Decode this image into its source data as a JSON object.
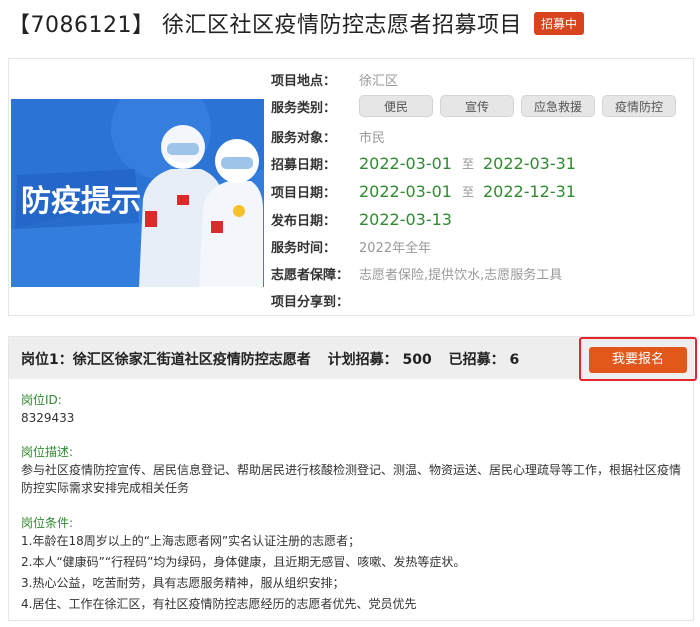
{
  "header": {
    "title": "【7086121】 徐汇区社区疫情防控志愿者招募项目",
    "status_badge": "招募中"
  },
  "poster": {
    "headline": "防疫提示"
  },
  "info": {
    "location": {
      "label": "项目地点：",
      "value": "徐汇区"
    },
    "service_type": {
      "label": "服务类别：",
      "tags": [
        "便民",
        "宣传",
        "应急救援",
        "疫情防控"
      ]
    },
    "service_target": {
      "label": "服务对象：",
      "value": "市民"
    },
    "recruit_date": {
      "label": "招募日期：",
      "start": "2022-03-01",
      "separator": "至",
      "end": "2022-03-31"
    },
    "project_date": {
      "label": "项目日期：",
      "start": "2022-03-01",
      "separator": "至",
      "end": "2022-12-31"
    },
    "publish_date": {
      "label": "发布日期：",
      "value": "2022-03-13"
    },
    "service_time": {
      "label": "服务时间：",
      "value": "2022年全年"
    },
    "guarantee": {
      "label": "志愿者保障：",
      "value": "志愿者保险,提供饮水,志愿服务工具"
    },
    "share": {
      "label": "项目分享到："
    }
  },
  "position": {
    "title": "岗位1：徐汇区徐家汇街道社区疫情防控志愿者",
    "plan_label": "计划招募：",
    "plan_value": "500",
    "recruited_label": "已招募：",
    "recruited_value": "6",
    "apply_label": "我要报名",
    "id_heading": "岗位ID:",
    "id_value": "8329433",
    "desc_heading": "岗位描述:",
    "desc_text": "参与社区疫情防控宣传、居民信息登记、帮助居民进行核酸检测登记、测温、物资运送、居民心理疏导等工作，根据社区疫情防控实际需求安排完成相关任务",
    "cond_heading": "岗位条件:",
    "conditions": [
      "1.年龄在18周岁以上的“上海志愿者网”实名认证注册的志愿者；",
      "2.本人“健康码”“行程码”均为绿码，身体健康，且近期无感冒、咳嗽、发热等症状。",
      "3.热心公益，吃苦耐劳，具有志愿服务精神，服从组织安排；",
      "4.居住、工作在徐汇区，有社区疫情防控志愿经历的志愿者优先、党员优先"
    ]
  },
  "colors": {
    "badge": "#d9441f",
    "date_green": "#2e8b2e",
    "apply_button": "#e2571c",
    "highlight_border": "#e5242b",
    "poster_blue": "#2b74d6"
  }
}
